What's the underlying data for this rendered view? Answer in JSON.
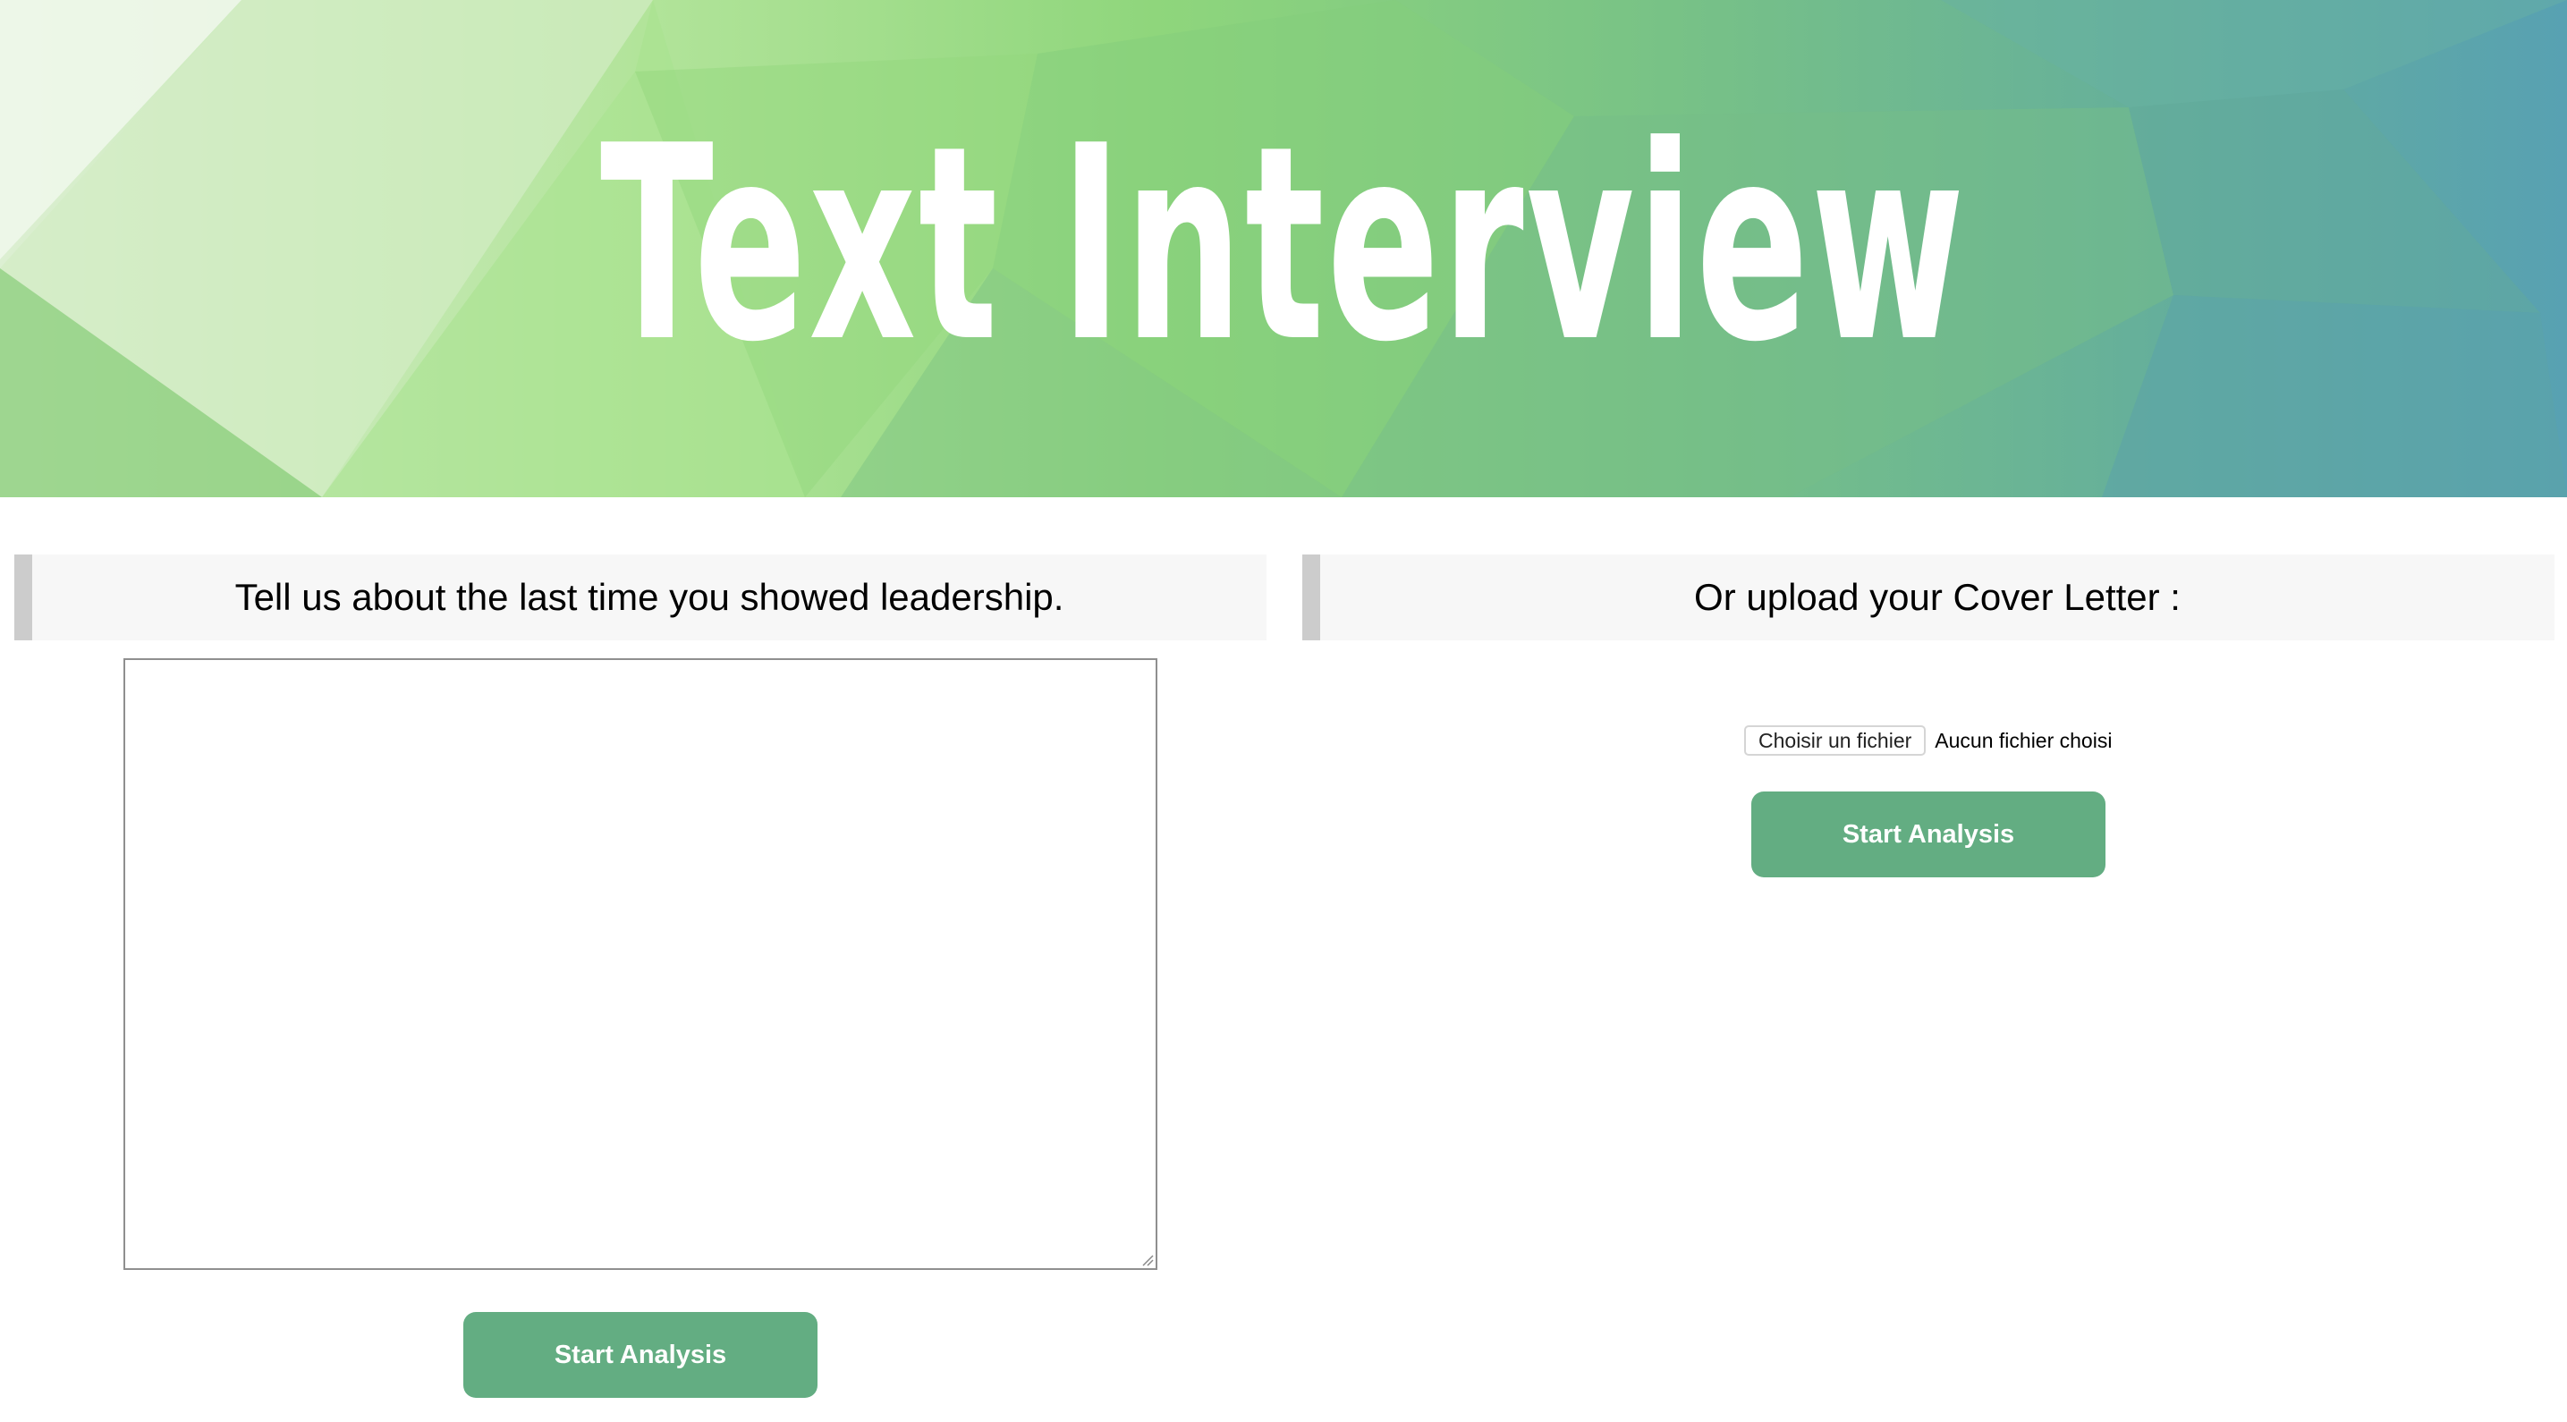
{
  "banner": {
    "title": "Text Interview"
  },
  "question_panel": {
    "prompt": "Tell us about the last time you showed leadership.",
    "answer_value": "",
    "submit_label": "Start Analysis"
  },
  "upload_panel": {
    "heading": "Or upload your Cover Letter :",
    "choose_file_label": "Choisir un fichier",
    "file_status": "Aucun fichier choisi",
    "submit_label": "Start Analysis"
  },
  "colors": {
    "button": "#63ad82",
    "header_bg": "#f7f7f7",
    "header_border": "#cccccc"
  }
}
